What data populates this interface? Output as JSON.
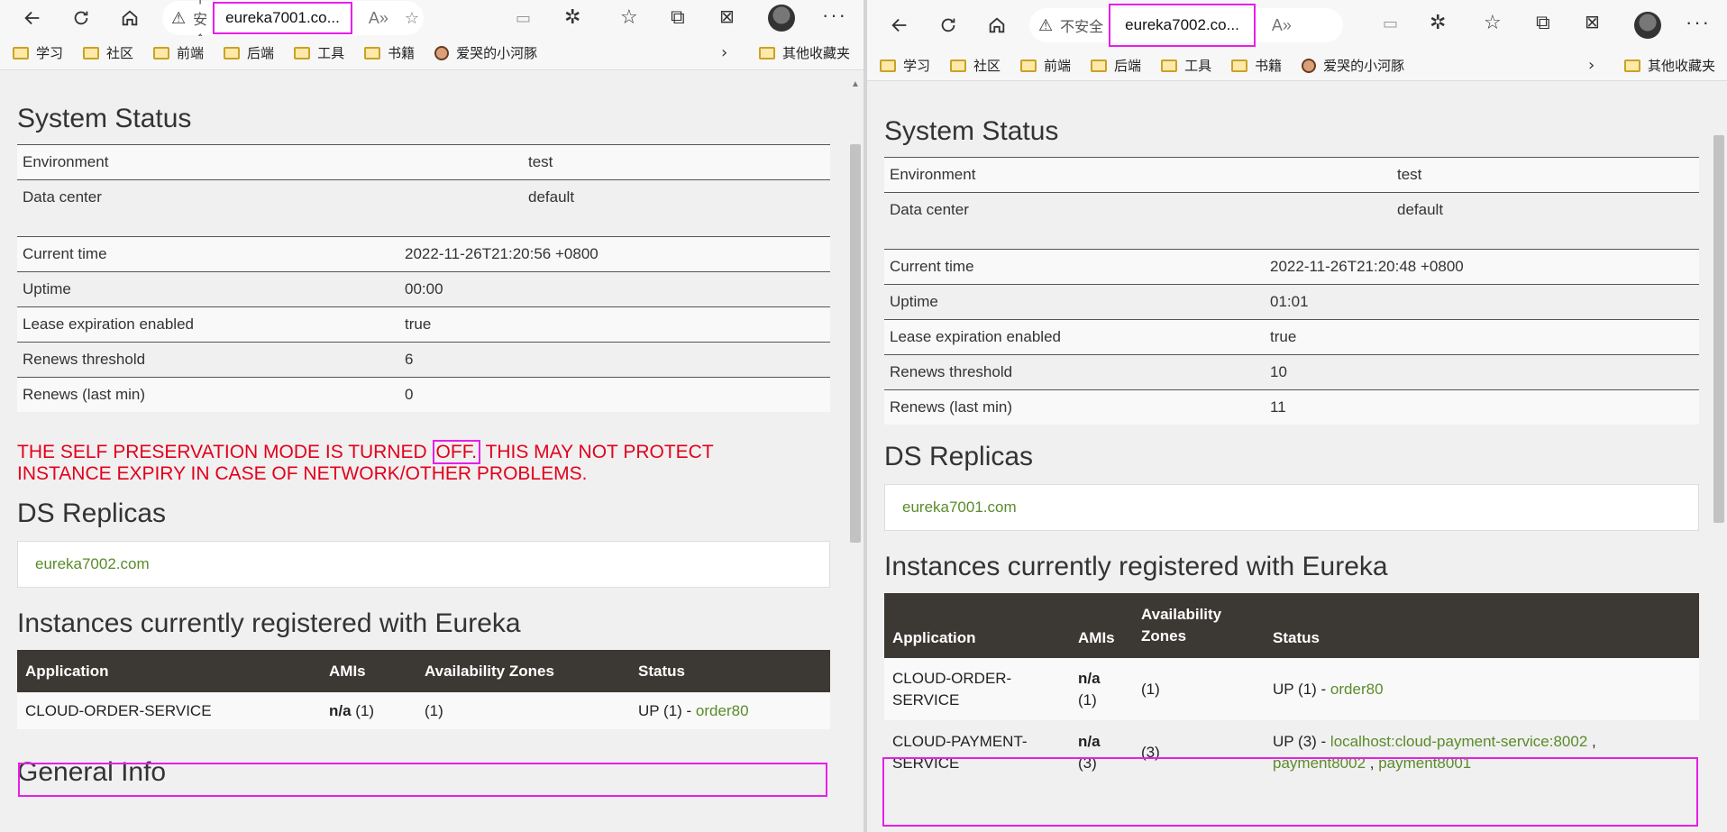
{
  "left": {
    "url": "eureka7001.co...",
    "insecure_label": "不安全",
    "bookmarks": [
      "学习",
      "社区",
      "前端",
      "后端",
      "工具",
      "书籍"
    ],
    "bookmark_face": "爱哭的小河豚",
    "other_bookmarks": "其他收藏夹",
    "system_status_title": "System Status",
    "env_rows": [
      {
        "k": "Environment",
        "v": "test"
      },
      {
        "k": "Data center",
        "v": "default"
      }
    ],
    "status_rows": [
      {
        "k": "Current time",
        "v": "2022-11-26T21:20:56 +0800"
      },
      {
        "k": "Uptime",
        "v": "00:00"
      },
      {
        "k": "Lease expiration enabled",
        "v": "true"
      },
      {
        "k": "Renews threshold",
        "v": "6"
      },
      {
        "k": "Renews (last min)",
        "v": "0"
      }
    ],
    "warning_pre": "THE SELF PRESERVATION MODE IS TURNED ",
    "warning_off": "OFF.",
    "warning_post": " THIS MAY NOT PROTECT INSTANCE EXPIRY IN CASE OF NETWORK/OTHER PROBLEMS.",
    "ds_replicas_title": "DS Replicas",
    "replica": "eureka7002.com",
    "instances_title": "Instances currently registered with Eureka",
    "instance_headers": [
      "Application",
      "AMIs",
      "Availability Zones",
      "Status"
    ],
    "instances": [
      {
        "app": "CLOUD-ORDER-SERVICE",
        "ami_bold": "n/a",
        "ami_rest": " (1)",
        "zones": "(1)",
        "status_prefix": "UP (1) - ",
        "links": [
          "order80"
        ]
      }
    ],
    "general_info_title": "General Info"
  },
  "right": {
    "url": "eureka7002.co...",
    "insecure_label": "不安全",
    "bookmarks": [
      "学习",
      "社区",
      "前端",
      "后端",
      "工具",
      "书籍"
    ],
    "bookmark_face": "爱哭的小河豚",
    "other_bookmarks": "其他收藏夹",
    "system_status_title": "System Status",
    "env_rows": [
      {
        "k": "Environment",
        "v": "test"
      },
      {
        "k": "Data center",
        "v": "default"
      }
    ],
    "status_rows": [
      {
        "k": "Current time",
        "v": "2022-11-26T21:20:48 +0800"
      },
      {
        "k": "Uptime",
        "v": "01:01"
      },
      {
        "k": "Lease expiration enabled",
        "v": "true"
      },
      {
        "k": "Renews threshold",
        "v": "10"
      },
      {
        "k": "Renews (last min)",
        "v": "11"
      }
    ],
    "ds_replicas_title": "DS Replicas",
    "replica": "eureka7001.com",
    "instances_title": "Instances currently registered with Eureka",
    "instance_headers": [
      "Application",
      "AMIs",
      "Availability Zones",
      "Status"
    ],
    "instances": [
      {
        "app_line1": "CLOUD-ORDER-",
        "app_line2": "SERVICE",
        "ami_line1": "n/a",
        "ami_line2": "(1)",
        "zones": "(1)",
        "status_prefix": "UP (1) - ",
        "links": [
          "order80"
        ]
      },
      {
        "app_line1": "CLOUD-PAYMENT-",
        "app_line2": "SERVICE",
        "ami_line1": "n/a",
        "ami_line2": "(3)",
        "zones": "(3)",
        "status_prefix": "UP (3) - ",
        "links": [
          "localhost:cloud-payment-service:8002",
          "payment8002",
          "payment8001"
        ]
      }
    ]
  }
}
